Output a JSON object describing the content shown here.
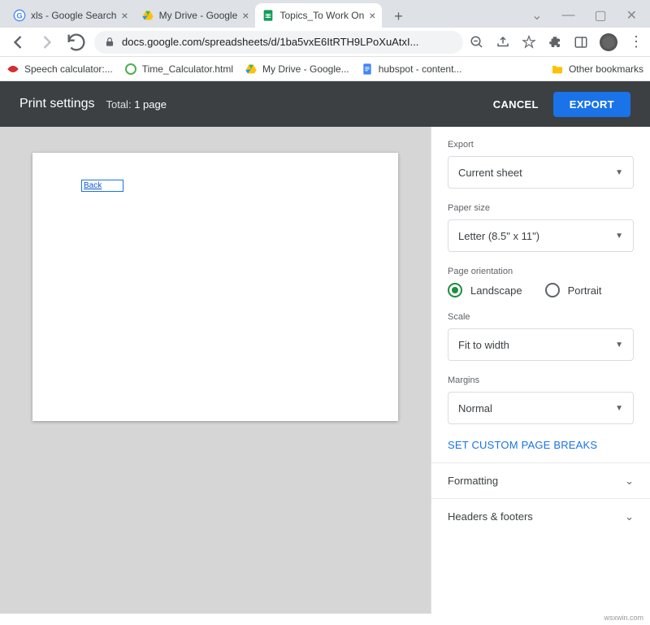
{
  "browser": {
    "tabs": [
      {
        "title": "xls - Google Search",
        "favicon": "google"
      },
      {
        "title": "My Drive - Google",
        "favicon": "drive"
      },
      {
        "title": "Topics_To Work On",
        "favicon": "sheets"
      }
    ],
    "url": "docs.google.com/spreadsheets/d/1ba5vxE6ItRTH9LPoXuAtxI..."
  },
  "bookmarks": [
    {
      "label": "Speech calculator:...",
      "icon": "red"
    },
    {
      "label": "Time_Calculator.html",
      "icon": "green"
    },
    {
      "label": "My Drive - Google...",
      "icon": "drive"
    },
    {
      "label": "hubspot - content...",
      "icon": "docs"
    }
  ],
  "bookmarks_other": "Other bookmarks",
  "header": {
    "title": "Print settings",
    "total_label": "Total:",
    "total_value": "1 page",
    "cancel": "CANCEL",
    "export": "EXPORT"
  },
  "preview": {
    "cell_text": "Back"
  },
  "panel": {
    "export_label": "Export",
    "export_value": "Current sheet",
    "paper_label": "Paper size",
    "paper_value": "Letter (8.5\" x 11\")",
    "orientation_label": "Page orientation",
    "landscape": "Landscape",
    "portrait": "Portrait",
    "scale_label": "Scale",
    "scale_value": "Fit to width",
    "margins_label": "Margins",
    "margins_value": "Normal",
    "custom_breaks": "SET CUSTOM PAGE BREAKS",
    "formatting": "Formatting",
    "headers_footers": "Headers & footers"
  },
  "footer": "wsxwin.com"
}
